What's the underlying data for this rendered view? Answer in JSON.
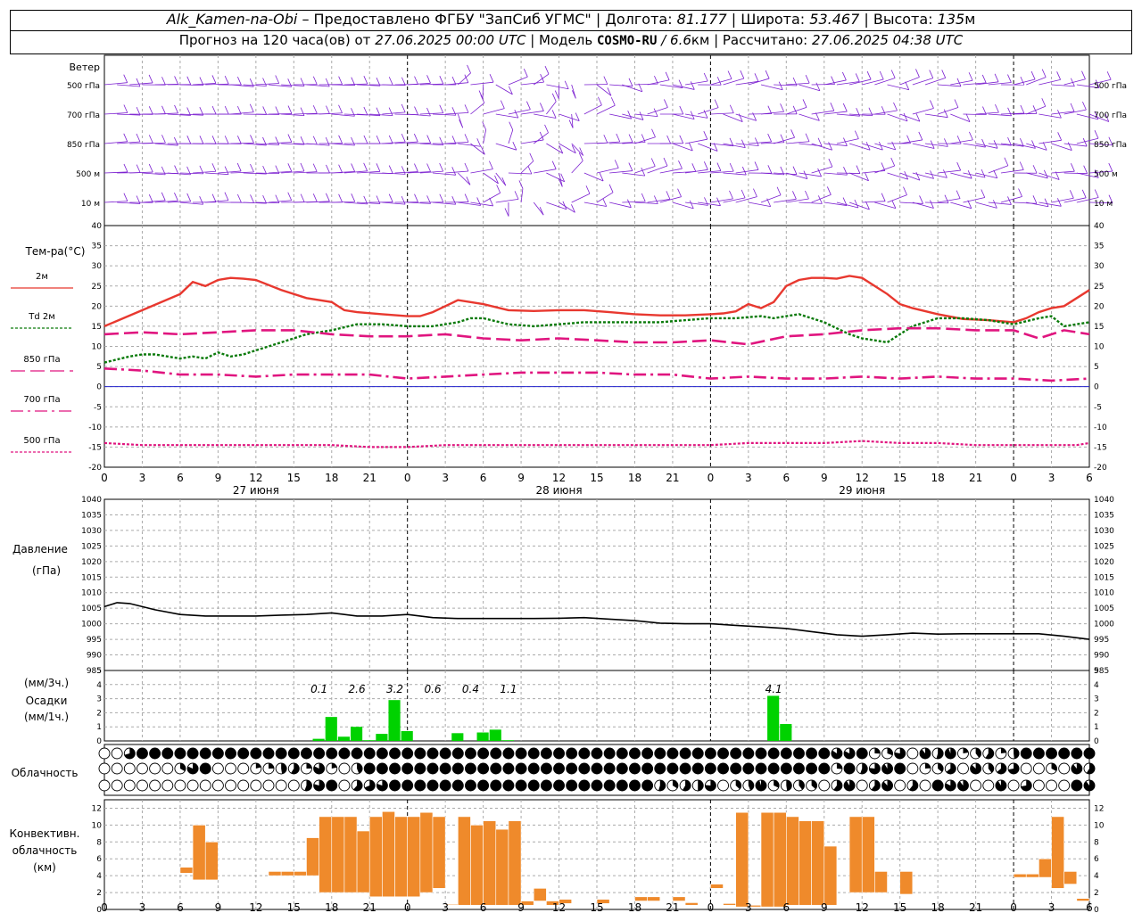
{
  "header": {
    "station": "Alk_Kamen-na-Obi",
    "provider": "– Предоставлено ФГБУ \"ЗапСиб УГМС\"",
    "lon_label": "| Долгота:",
    "lon_value": "81.177",
    "lat_label": "| Широта:",
    "lat_value": "53.467",
    "alt_label": "| Высота:",
    "alt_value": "135",
    "alt_unit": "м",
    "forecast_prefix": "Прогноз на 120 часа(ов) от",
    "forecast_start": "27.06.2025 00:00 UTC",
    "model_label": "| Модель",
    "model_name": "COSMO-RU",
    "model_res": "/ 6.6",
    "model_res_unit": "км",
    "calc_label": "| Рассчитано:",
    "calc_time": "27.06.2025 04:38 UTC"
  },
  "colors": {
    "wind": "#7b1fd0",
    "t2m": "#e8382f",
    "td2m": "#0a7a0a",
    "t850": "#e0157f",
    "precip": "#00d200",
    "convective": "#ef8a2b",
    "pressure": "#000000",
    "zero_line": "#2222cc"
  },
  "wind_panel": {
    "title": "Ветер",
    "levels": [
      "500 гПа",
      "700 гПа",
      "850 гПа",
      "500 м",
      "10  м"
    ]
  },
  "temp_panel": {
    "title": "Тем-ра(°C)",
    "legend": [
      {
        "label": "2м",
        "style": "solid",
        "color": "#e8382f"
      },
      {
        "label": "Td  2м",
        "style": "dotted",
        "color": "#0a7a0a"
      },
      {
        "label": "850 гПа",
        "style": "dashed",
        "color": "#e0157f"
      },
      {
        "label": "700 гПа",
        "style": "dashdot",
        "color": "#e0157f"
      },
      {
        "label": "500 гПа",
        "style": "dotted",
        "color": "#e0157f"
      }
    ]
  },
  "pressure_panel": {
    "title1": "Давление",
    "title2": "(гПа)"
  },
  "precip_panel": {
    "title1": "(мм/3ч.)",
    "title2": "Осадки",
    "title3": "(мм/1ч.)",
    "totals": [
      {
        "x": 17,
        "label": "0.1"
      },
      {
        "x": 20,
        "label": "2.6"
      },
      {
        "x": 23,
        "label": "3.2"
      },
      {
        "x": 26,
        "label": "0.6"
      },
      {
        "x": 29,
        "label": "0.4"
      },
      {
        "x": 32,
        "label": "1.1"
      },
      {
        "x": 53,
        "label": "4.1"
      }
    ]
  },
  "cloud_panel": {
    "title": "Облачность"
  },
  "conv_panel": {
    "title1": "Конвективн.",
    "title2": "облачность",
    "title3": "(км)"
  },
  "dates": [
    {
      "x": 12,
      "label": "27 июня"
    },
    {
      "x": 36,
      "label": "28 июня"
    },
    {
      "x": 60,
      "label": "29 июня"
    }
  ],
  "chart_data": [
    {
      "type": "line",
      "title": "Тем-ра(°C)",
      "x_unit": "hours from 27.06.2025 00:00 UTC",
      "xlim": [
        0,
        78
      ],
      "ylim": [
        -20,
        40
      ],
      "x_tick_labels": [
        "0",
        "3",
        "6",
        "9",
        "12",
        "15",
        "18",
        "21",
        "0",
        "3",
        "6",
        "9",
        "12",
        "15",
        "18",
        "21",
        "0",
        "3",
        "6",
        "9",
        "12",
        "15",
        "18",
        "21",
        "0",
        "3",
        "6"
      ],
      "y_ticks": [
        -20,
        -15,
        -10,
        -5,
        0,
        5,
        10,
        15,
        20,
        25,
        30,
        35,
        40
      ],
      "series": [
        {
          "name": "2м",
          "x": [
            0,
            3,
            6,
            7,
            8,
            9,
            10,
            11,
            12,
            14,
            16,
            18,
            19,
            20,
            22,
            24,
            25,
            26,
            27,
            28,
            30,
            32,
            34,
            36,
            38,
            40,
            42,
            44,
            46,
            48,
            49,
            50,
            51,
            52,
            53,
            54,
            55,
            56,
            57,
            58,
            59,
            60,
            61,
            62,
            63,
            64,
            66,
            68,
            70,
            72,
            73,
            74,
            75,
            76,
            78
          ],
          "y": [
            15,
            19,
            23,
            26,
            25,
            26.5,
            27,
            26.8,
            26.5,
            24,
            22,
            21,
            19,
            18.5,
            18,
            17.5,
            17.5,
            18.5,
            20,
            21.5,
            20.5,
            19,
            18.8,
            19,
            19,
            18.5,
            18,
            17.7,
            17.7,
            18,
            18.2,
            18.7,
            20.5,
            19.5,
            21,
            25,
            26.5,
            27,
            27,
            26.8,
            27.5,
            27,
            25,
            23,
            20.5,
            19.5,
            18,
            16.8,
            16.5,
            16,
            17,
            18.5,
            19.5,
            20,
            24
          ]
        },
        {
          "name": "Td 2м",
          "x": [
            0,
            2,
            3,
            4,
            5,
            6,
            7,
            8,
            9,
            10,
            11,
            12,
            14,
            16,
            18,
            20,
            22,
            24,
            26,
            28,
            29,
            30,
            32,
            34,
            36,
            38,
            40,
            42,
            44,
            46,
            48,
            50,
            52,
            53,
            54,
            55,
            56,
            57,
            58,
            59,
            60,
            61,
            62,
            63,
            64,
            66,
            68,
            70,
            72,
            74,
            75,
            76,
            78
          ],
          "y": [
            6,
            7.5,
            8,
            8,
            7.5,
            7,
            7.5,
            7,
            8.5,
            7.5,
            8,
            9,
            11,
            13,
            14,
            15.5,
            15.5,
            15,
            15,
            16,
            17,
            17,
            15.5,
            15,
            15.5,
            16,
            16,
            16,
            16,
            16.5,
            17,
            17,
            17.5,
            17,
            17.5,
            18,
            17,
            16,
            14.5,
            13,
            12,
            11.5,
            11,
            13,
            15,
            17,
            17,
            16.5,
            15.5,
            17,
            17.5,
            15,
            16
          ]
        },
        {
          "name": "850 гПа",
          "x": [
            0,
            3,
            6,
            9,
            12,
            15,
            18,
            21,
            24,
            27,
            30,
            33,
            36,
            39,
            42,
            45,
            48,
            51,
            54,
            57,
            60,
            63,
            66,
            69,
            72,
            74,
            76,
            78
          ],
          "y": [
            13,
            13.5,
            13,
            13.5,
            14,
            14,
            13,
            12.5,
            12.5,
            13,
            12,
            11.5,
            12,
            11.5,
            11,
            11,
            11.5,
            10.5,
            12.5,
            13,
            14,
            14.5,
            14.5,
            14,
            14,
            12,
            14,
            13
          ]
        },
        {
          "name": "700 гПа",
          "x": [
            0,
            3,
            6,
            9,
            12,
            15,
            18,
            21,
            24,
            27,
            30,
            33,
            36,
            39,
            42,
            45,
            48,
            51,
            54,
            57,
            60,
            63,
            66,
            69,
            72,
            75,
            78
          ],
          "y": [
            4.5,
            4,
            3,
            3,
            2.5,
            3,
            3,
            3,
            2,
            2.5,
            3,
            3.5,
            3.5,
            3.5,
            3,
            3,
            2,
            2.5,
            2,
            2,
            2.5,
            2,
            2.5,
            2,
            2,
            1.5,
            2
          ]
        },
        {
          "name": "500 гПа",
          "x": [
            0,
            3,
            6,
            9,
            12,
            15,
            18,
            21,
            24,
            27,
            30,
            33,
            36,
            39,
            42,
            45,
            48,
            51,
            54,
            57,
            60,
            63,
            66,
            69,
            72,
            75,
            77,
            78
          ],
          "y": [
            -14,
            -14.5,
            -14.5,
            -14.5,
            -14.5,
            -14.5,
            -14.5,
            -15,
            -15,
            -14.5,
            -14.5,
            -14.5,
            -14.5,
            -14.5,
            -14.5,
            -14.5,
            -14.5,
            -14,
            -14,
            -14,
            -13.5,
            -14,
            -14,
            -14.5,
            -14.5,
            -14.5,
            -14.5,
            -14
          ]
        }
      ]
    },
    {
      "type": "line",
      "title": "Давление (гПа)",
      "xlim": [
        0,
        78
      ],
      "ylim": [
        985,
        1040
      ],
      "y_ticks": [
        985,
        990,
        995,
        1000,
        1005,
        1010,
        1015,
        1020,
        1025,
        1030,
        1035,
        1040
      ],
      "series": [
        {
          "x": [
            0,
            1,
            2,
            3,
            4,
            6,
            8,
            12,
            14,
            16,
            18,
            20,
            22,
            24,
            26,
            28,
            30,
            32,
            34,
            36,
            38,
            40,
            42,
            44,
            46,
            48,
            50,
            52,
            54,
            56,
            58,
            60,
            62,
            64,
            66,
            68,
            70,
            72,
            74,
            76,
            78
          ],
          "y": [
            1005.5,
            1006.8,
            1006.5,
            1005.5,
            1004.5,
            1003,
            1002.5,
            1002.5,
            1002.8,
            1003,
            1003.5,
            1002.5,
            1002.5,
            1003,
            1002,
            1001.7,
            1001.7,
            1001.7,
            1001.7,
            1001.8,
            1002,
            1001.5,
            1001,
            1000.2,
            1000,
            1000,
            999.5,
            999,
            998.5,
            997.5,
            996.5,
            996,
            996.5,
            997,
            996.7,
            996.8,
            996.8,
            996.8,
            996.8,
            996,
            995
          ]
        }
      ]
    },
    {
      "type": "bar",
      "title": "Осадки (мм/1ч.)",
      "xlim": [
        0,
        78
      ],
      "ylim": [
        0,
        5
      ],
      "y_ticks": [
        0,
        1,
        2,
        3,
        4,
        5
      ],
      "x": [
        17,
        18,
        19,
        20,
        21,
        22,
        23,
        24,
        28,
        30,
        31,
        32,
        53,
        54
      ],
      "values": [
        0.15,
        1.7,
        0.3,
        1.0,
        0.05,
        0.5,
        2.9,
        0.7,
        0.55,
        0.6,
        0.8,
        0.05,
        3.2,
        1.2
      ]
    },
    {
      "type": "bar",
      "title": "Конвективн. облачность (км)",
      "xlim": [
        0,
        78
      ],
      "ylim": [
        0,
        13
      ],
      "y_ticks": [
        0,
        2,
        4,
        6,
        8,
        10,
        12
      ],
      "bars": [
        {
          "x": 6.5,
          "lo": 4.3,
          "hi": 5.0
        },
        {
          "x": 7.5,
          "lo": 3.5,
          "hi": 10.0
        },
        {
          "x": 8.5,
          "lo": 3.5,
          "hi": 8.0
        },
        {
          "x": 13.5,
          "lo": 4.0,
          "hi": 4.5
        },
        {
          "x": 14.5,
          "lo": 4.0,
          "hi": 4.5
        },
        {
          "x": 15.5,
          "lo": 4.0,
          "hi": 4.5
        },
        {
          "x": 16.5,
          "lo": 4.0,
          "hi": 8.5
        },
        {
          "x": 17.5,
          "lo": 2.0,
          "hi": 11.0
        },
        {
          "x": 18.5,
          "lo": 2.0,
          "hi": 11.0
        },
        {
          "x": 19.5,
          "lo": 2.0,
          "hi": 11.0
        },
        {
          "x": 20.5,
          "lo": 2.0,
          "hi": 9.3
        },
        {
          "x": 21.5,
          "lo": 1.5,
          "hi": 11.0
        },
        {
          "x": 22.5,
          "lo": 1.5,
          "hi": 11.6
        },
        {
          "x": 23.5,
          "lo": 1.5,
          "hi": 11.0
        },
        {
          "x": 24.5,
          "lo": 1.5,
          "hi": 11.0
        },
        {
          "x": 25.5,
          "lo": 2.0,
          "hi": 11.5
        },
        {
          "x": 26.5,
          "lo": 2.5,
          "hi": 11.0
        },
        {
          "x": 27.5,
          "lo": 0.5,
          "hi": 0.6
        },
        {
          "x": 28.5,
          "lo": 0.5,
          "hi": 11.0
        },
        {
          "x": 29.5,
          "lo": 0.5,
          "hi": 10.0
        },
        {
          "x": 30.5,
          "lo": 0.5,
          "hi": 10.5
        },
        {
          "x": 31.5,
          "lo": 0.5,
          "hi": 9.5
        },
        {
          "x": 32.5,
          "lo": 0.5,
          "hi": 10.5
        },
        {
          "x": 33.5,
          "lo": 0.5,
          "hi": 1.0
        },
        {
          "x": 34.5,
          "lo": 1.0,
          "hi": 2.5
        },
        {
          "x": 35.5,
          "lo": 0.5,
          "hi": 1.0
        },
        {
          "x": 36.5,
          "lo": 0.7,
          "hi": 1.2
        },
        {
          "x": 39.5,
          "lo": 0.7,
          "hi": 1.2
        },
        {
          "x": 42.5,
          "lo": 1.0,
          "hi": 1.5
        },
        {
          "x": 43.5,
          "lo": 1.0,
          "hi": 1.5
        },
        {
          "x": 45.5,
          "lo": 1.0,
          "hi": 1.5
        },
        {
          "x": 46.5,
          "lo": 0.5,
          "hi": 0.8
        },
        {
          "x": 48.5,
          "lo": 2.5,
          "hi": 3.0
        },
        {
          "x": 49.5,
          "lo": 0.5,
          "hi": 0.7
        },
        {
          "x": 50.5,
          "lo": 0.3,
          "hi": 11.5
        },
        {
          "x": 51.5,
          "lo": 0.3,
          "hi": 0.5
        },
        {
          "x": 52.5,
          "lo": 0.3,
          "hi": 11.5
        },
        {
          "x": 53.5,
          "lo": 0.3,
          "hi": 11.5
        },
        {
          "x": 54.5,
          "lo": 0.5,
          "hi": 11.0
        },
        {
          "x": 55.5,
          "lo": 0.5,
          "hi": 10.5
        },
        {
          "x": 56.5,
          "lo": 0.5,
          "hi": 10.5
        },
        {
          "x": 57.5,
          "lo": 0.5,
          "hi": 7.5
        },
        {
          "x": 59.5,
          "lo": 2.0,
          "hi": 11.0
        },
        {
          "x": 60.5,
          "lo": 2.0,
          "hi": 11.0
        },
        {
          "x": 61.5,
          "lo": 2.0,
          "hi": 4.5
        },
        {
          "x": 63.5,
          "lo": 1.8,
          "hi": 4.5
        },
        {
          "x": 72.5,
          "lo": 3.8,
          "hi": 4.2
        },
        {
          "x": 73.5,
          "lo": 3.8,
          "hi": 4.2
        },
        {
          "x": 74.5,
          "lo": 3.8,
          "hi": 6.0
        },
        {
          "x": 75.5,
          "lo": 2.5,
          "hi": 11.0
        },
        {
          "x": 76.5,
          "lo": 3.0,
          "hi": 4.5
        },
        {
          "x": 77.5,
          "lo": 1.0,
          "hi": 1.3
        }
      ]
    }
  ]
}
